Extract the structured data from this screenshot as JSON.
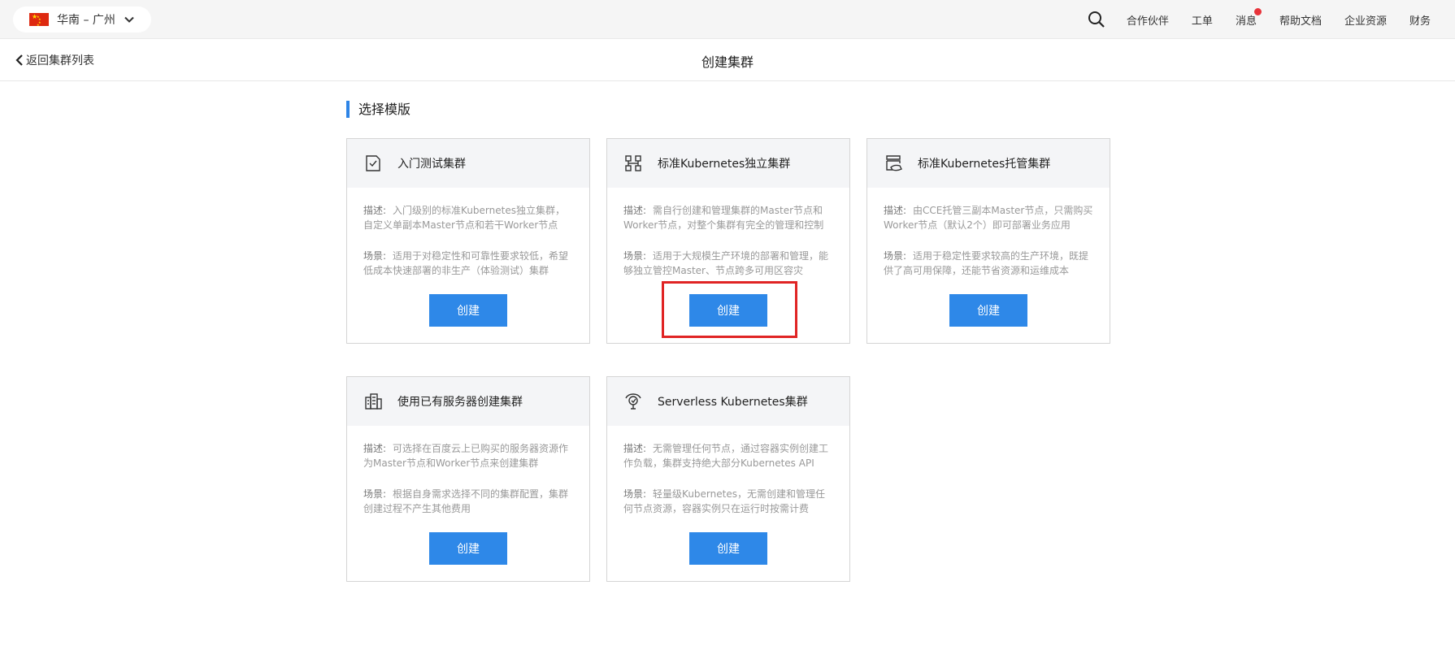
{
  "topbar": {
    "region": "华南 – 广州",
    "nav": [
      "合作伙伴",
      "工单",
      "消息",
      "帮助文档",
      "企业资源",
      "财务"
    ]
  },
  "subheader": {
    "back_label": "返回集群列表",
    "title": "创建集群"
  },
  "section_title": "选择模版",
  "cards": [
    {
      "title": "入门测试集群",
      "icon": "checklist-icon",
      "desc_label": "描述:",
      "desc": "入门级别的标准Kubernetes独立集群，自定义单副本Master节点和若干Worker节点",
      "scene_label": "场景:",
      "scene": "适用于对稳定性和可靠性要求较低，希望低成本快速部署的非生产（体验测试）集群",
      "button": "创建"
    },
    {
      "title": "标准Kubernetes独立集群",
      "icon": "cluster-nodes-icon",
      "desc_label": "描述:",
      "desc": "需自行创建和管理集群的Master节点和Worker节点，对整个集群有完全的管理和控制",
      "scene_label": "场景:",
      "scene": "适用于大规模生产环境的部署和管理，能够独立管控Master、节点跨多可用区容灾",
      "button": "创建"
    },
    {
      "title": "标准Kubernetes托管集群",
      "icon": "managed-server-icon",
      "desc_label": "描述:",
      "desc": "由CCE托管三副本Master节点，只需购买Worker节点（默认2个）即可部署业务应用",
      "scene_label": "场景:",
      "scene": "适用于稳定性要求较高的生产环境，既提供了高可用保障，还能节省资源和运维成本",
      "button": "创建"
    },
    {
      "title": "使用已有服务器创建集群",
      "icon": "buildings-icon",
      "desc_label": "描述:",
      "desc": "可选择在百度云上已购买的服务器资源作为Master节点和Worker节点来创建集群",
      "scene_label": "场景:",
      "scene": "根据自身需求选择不同的集群配置，集群创建过程不产生其他费用",
      "button": "创建"
    },
    {
      "title": "Serverless Kubernetes集群",
      "icon": "serverless-icon",
      "desc_label": "描述:",
      "desc": "无需管理任何节点，通过容器实例创建工作负载，集群支持绝大部分Kubernetes API",
      "scene_label": "场景:",
      "scene": "轻量级Kubernetes，无需创建和管理任何节点资源，容器实例只在运行时按需计费",
      "button": "创建"
    }
  ],
  "colors": {
    "accent": "#2e88e8",
    "highlight": "#e02424",
    "badge": "#e8333a"
  }
}
